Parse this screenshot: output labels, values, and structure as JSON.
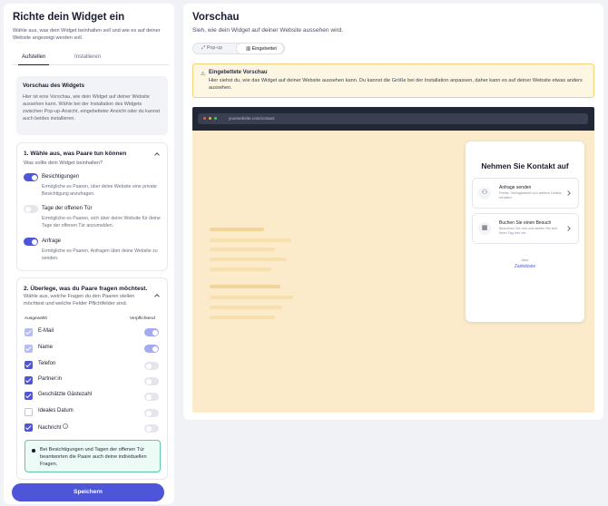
{
  "left": {
    "title": "Richte dein Widget ein",
    "subtitle": "Wähle aus, was dein Widget beinhalten soll und wie es auf deiner Website angezeigt werden soll.",
    "tabs": [
      {
        "label": "Aufstellen",
        "active": true
      },
      {
        "label": "Installieren",
        "active": false
      }
    ],
    "preview_box": {
      "title": "Vorschau des Widgets",
      "text": "Hier ist eine Vorschau, wie dein Widget auf deiner Website aussehen kann. Wähle bei der Installation des Widgets zwischen Pop-up-Ansicht, eingebetteter Ansicht oder du kannst auch beides installieren."
    },
    "section1": {
      "title": "1. Wähle aus, was Paare tun können",
      "subtitle": "Was sollte dein Widget beinhalten?",
      "options": [
        {
          "label": "Besichtigungen",
          "desc": "Ermögliche es Paaren, über deine Website eine private Besichtigung anzufragen.",
          "on": true
        },
        {
          "label": "Tage der offenen Tür",
          "desc": "Ermögliche es Paaren, sich über deine Website für deine Tage der offenen Tür anzumelden.",
          "on": false
        },
        {
          "label": "Anfrage",
          "desc": "Ermögliche es Paaren, Anfragen über deine Website zu senden.",
          "on": true
        }
      ]
    },
    "section2": {
      "title": "2. Überlege, was du Paare fragen möchtest.",
      "subtitle": "Wähle aus, welche Fragen du den Paaren stellen möchtest und welche Felder Pflichtfelder sind.",
      "col_selected": "Ausgewählt",
      "col_required": "Verpflichtend",
      "fields": [
        {
          "label": "E-Mail",
          "selected": true,
          "locked": true,
          "required": true
        },
        {
          "label": "Name",
          "selected": true,
          "locked": true,
          "required": true
        },
        {
          "label": "Telefon",
          "selected": true,
          "locked": false,
          "required": false
        },
        {
          "label": "Partner:in",
          "selected": true,
          "locked": false,
          "required": false
        },
        {
          "label": "Geschätzte Gästezahl",
          "selected": true,
          "locked": false,
          "required": false
        },
        {
          "label": "Ideales Datum",
          "selected": false,
          "locked": false,
          "required": false
        },
        {
          "label": "Nachricht",
          "selected": true,
          "locked": false,
          "required": false,
          "info": true
        }
      ],
      "note": "Bei Besichtigungen und Tagen der offenen Tür beantworten die Paare auch deine individuellen Fragen."
    },
    "save_label": "Speichern"
  },
  "right": {
    "title": "Vorschau",
    "subtitle": "Sieh, wie dein Widget auf deiner Website aussehen wird.",
    "modes": [
      {
        "label": "Pop-up",
        "icon": "expand-icon",
        "active": false
      },
      {
        "label": "Eingebettet",
        "icon": "layout-icon",
        "active": true
      }
    ],
    "warning": {
      "title": "Eingebettete Vorschau",
      "text": "Hier siehst du, wie das Widget auf deiner Website aussehen kann. Du kannst die Größe bei der Installation anpassen, daher kann es auf deiner Website etwas anders aussehen."
    },
    "browser_url": "yourwebsite.com/contact",
    "widget": {
      "heading": "Nehmen Sie Kontakt auf",
      "cards": [
        {
          "title": "Anfrage senden",
          "desc": "Preise, Verfügbarkeit und weitere Details erhalten.",
          "icon": "people-icon"
        },
        {
          "title": "Buchen Sie einen Besuch",
          "desc": "Besuchen Sie uns und stellen Sie sich Ihren Tag hier vor.",
          "icon": "calendar-icon"
        }
      ],
      "by": "Über",
      "brand": "Zankdooie"
    },
    "colors": {
      "accent": "#4f55d8",
      "warning_bg": "#fdf6e3",
      "preview_bg": "#fcebcb",
      "note_border": "#5ec7a4"
    }
  }
}
